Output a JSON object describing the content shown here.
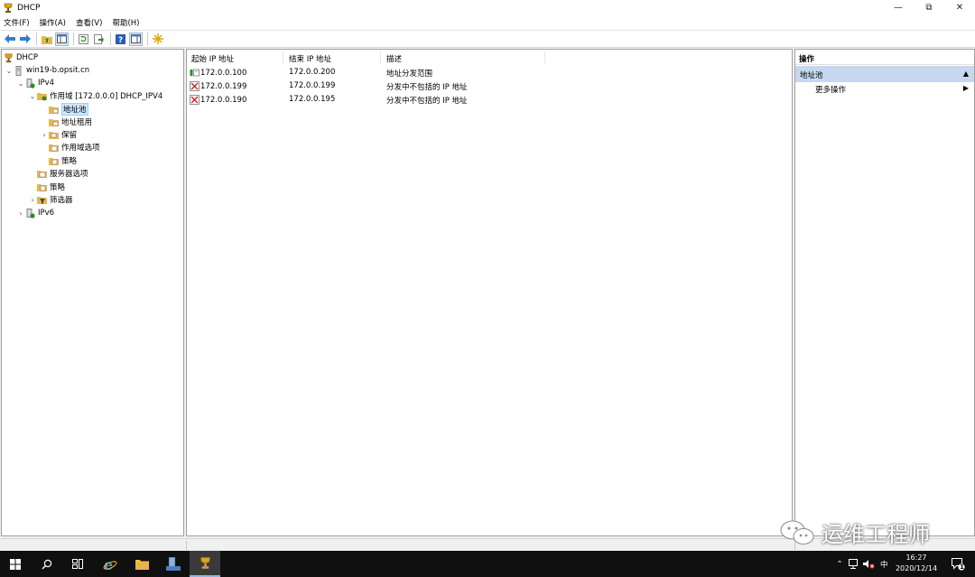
{
  "window": {
    "title": "DHCP",
    "minimize": "—",
    "restore": "⧉",
    "close": "✕"
  },
  "menu": [
    "文件(F)",
    "操作(A)",
    "查看(V)",
    "帮助(H)"
  ],
  "tree": {
    "root": "DHCP",
    "server": "win19-b.opsit.cn",
    "ipv4": "IPv4",
    "scope": "作用域 [172.0.0.0] DHCP_IPV4",
    "address_pool": "地址池",
    "address_leases": "地址租用",
    "reservations": "保留",
    "scope_options": "作用域选项",
    "scope_policies": "策略",
    "server_options": "服务器选项",
    "policies": "策略",
    "filters": "筛选器",
    "ipv6": "IPv6"
  },
  "list": {
    "columns": [
      "起始 IP 地址",
      "结束 IP 地址",
      "描述"
    ],
    "rows": [
      {
        "start": "172.0.0.100",
        "end": "172.0.0.200",
        "desc": "地址分发范围",
        "icon": "range-icon"
      },
      {
        "start": "172.0.0.199",
        "end": "172.0.0.199",
        "desc": "分发中不包括的 IP 地址",
        "icon": "exclusion-icon"
      },
      {
        "start": "172.0.0.190",
        "end": "172.0.0.195",
        "desc": "分发中不包括的 IP 地址",
        "icon": "exclusion-icon"
      }
    ]
  },
  "actions": {
    "header": "操作",
    "section": "地址池",
    "more": "更多操作"
  },
  "taskbar": {
    "time": "16:27",
    "date": "2020/12/14",
    "ime": "中",
    "notification_count": "1"
  },
  "watermark": "运维工程师",
  "colors": {
    "selection": "#cce8ff",
    "action_section": "#c5d8ef",
    "taskbar": "#101010"
  }
}
